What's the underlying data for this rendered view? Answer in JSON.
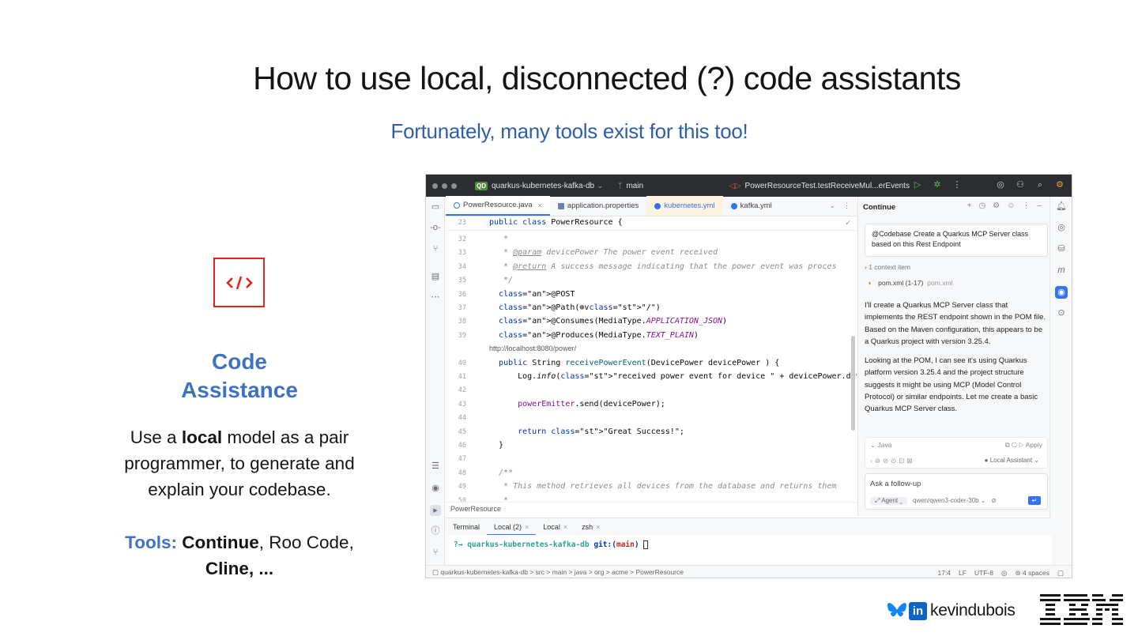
{
  "slide": {
    "title": "How to use local, disconnected (?) code assistants",
    "subtitle": "Fortunately, many tools exist for this too!",
    "section_title_1": "Code",
    "section_title_2": "Assistance",
    "body_pre": "Use a ",
    "body_bold": "local",
    "body_post": " model as a pair programmer, to generate and explain your codebase.",
    "tools_label": "Tools:",
    "tools_bold1": "Continue",
    "tools_mid": ", Roo Code,",
    "tools_bold2": "Cline, ..."
  },
  "ide": {
    "project": "quarkus-kubernetes-kafka-db",
    "project_badge": "QD",
    "branch": "main",
    "run_config": "PowerResourceTest.testReceiveMul...erEvents",
    "tabs": [
      {
        "label": "PowerResource.java",
        "color": "#3574f0"
      },
      {
        "label": "application.properties",
        "color": "#6d7fb0"
      },
      {
        "label": "kubernetes.yml",
        "color": "#3574f0"
      },
      {
        "label": "kafka.yml",
        "color": "#3574f0"
      }
    ],
    "sticky_line_no": "23",
    "sticky_code": "public class PowerResource {",
    "lines": [
      {
        "no": "32",
        "code": "   *"
      },
      {
        "no": "33",
        "code": "   * @param devicePower The power event received"
      },
      {
        "no": "34",
        "code": "   * @return A success message indicating that the power event was proces"
      },
      {
        "no": "35",
        "code": "   */"
      },
      {
        "no": "36",
        "code": "  @POST"
      },
      {
        "no": "37",
        "code": "  @Path(⊕v\"/\")"
      },
      {
        "no": "38",
        "code": "  @Consumes(MediaType.APPLICATION_JSON)"
      },
      {
        "no": "39",
        "code": "  @Produces(MediaType.TEXT_PLAIN)"
      },
      {
        "no": "",
        "code": "http://localhost:8080/power/"
      },
      {
        "no": "40",
        "code": "  public String receivePowerEvent(DevicePower devicePower ) {"
      },
      {
        "no": "41",
        "code": "      Log.info(\"received power event for device \" + devicePower.device()"
      },
      {
        "no": "42",
        "code": ""
      },
      {
        "no": "43",
        "code": "      powerEmitter.send(devicePower);"
      },
      {
        "no": "44",
        "code": ""
      },
      {
        "no": "45",
        "code": "      return \"Great Success!\";"
      },
      {
        "no": "46",
        "code": "  }"
      },
      {
        "no": "47",
        "code": ""
      },
      {
        "no": "48",
        "code": "  /**"
      },
      {
        "no": "49",
        "code": "   * This method retrieves all devices from the database and returns them"
      },
      {
        "no": "50",
        "code": "   *"
      }
    ],
    "editor_breadcrumb": "PowerResource",
    "chat": {
      "title": "Continue",
      "prompt_tag": "@Codebase",
      "prompt_text": "Create a Quarkus MCP Server class based on this Rest Endpoint",
      "context": "1 context item",
      "pom_label": "pom.xml (1-17)",
      "pom_file": "pom.xml",
      "answer_1": "I'll create a Quarkus MCP Server class that implements the REST endpoint shown in the POM file. Based on the Maven configuration, this appears to be a Quarkus project with version 3.25.4.",
      "answer_2": "Looking at the POM, I can see it's using Quarkus platform version 3.25.4 and the project structure suggests it might be using MCP (Model Control Protocol) or similar endpoints. Let me create a basic Quarkus MCP Server class.",
      "code_lang": "Java",
      "apply": "Apply",
      "assistant": "Local Assistant",
      "followup_placeholder": "Ask a follow-up",
      "agent": "Agent",
      "model": "qwen/qwen3-coder-30b"
    },
    "terminal": {
      "tabs": [
        {
          "label": "Terminal",
          "closable": false
        },
        {
          "label": "Local (2)",
          "closable": true
        },
        {
          "label": "Local",
          "closable": true
        },
        {
          "label": "zsh",
          "closable": true
        }
      ],
      "prompt_arrow": "?→",
      "path": "quarkus-kubernetes-kafka-db",
      "git": "git:(",
      "branch": "main",
      "git_close": ")"
    },
    "status": {
      "path": "quarkus-kubernetes-kafka-db  >  src  >  main  >  java  >  org  >  acme  >  PowerResource",
      "position": "17:4",
      "line_sep": "LF",
      "encoding": "UTF-8",
      "indent": "4 spaces"
    }
  },
  "footer": {
    "handle": "kevindubois",
    "linkedin_glyph": "in"
  },
  "colors": {
    "accent_blue": "#3d73c1",
    "red": "#e8211d",
    "ide_dark": "#2b2d30"
  }
}
